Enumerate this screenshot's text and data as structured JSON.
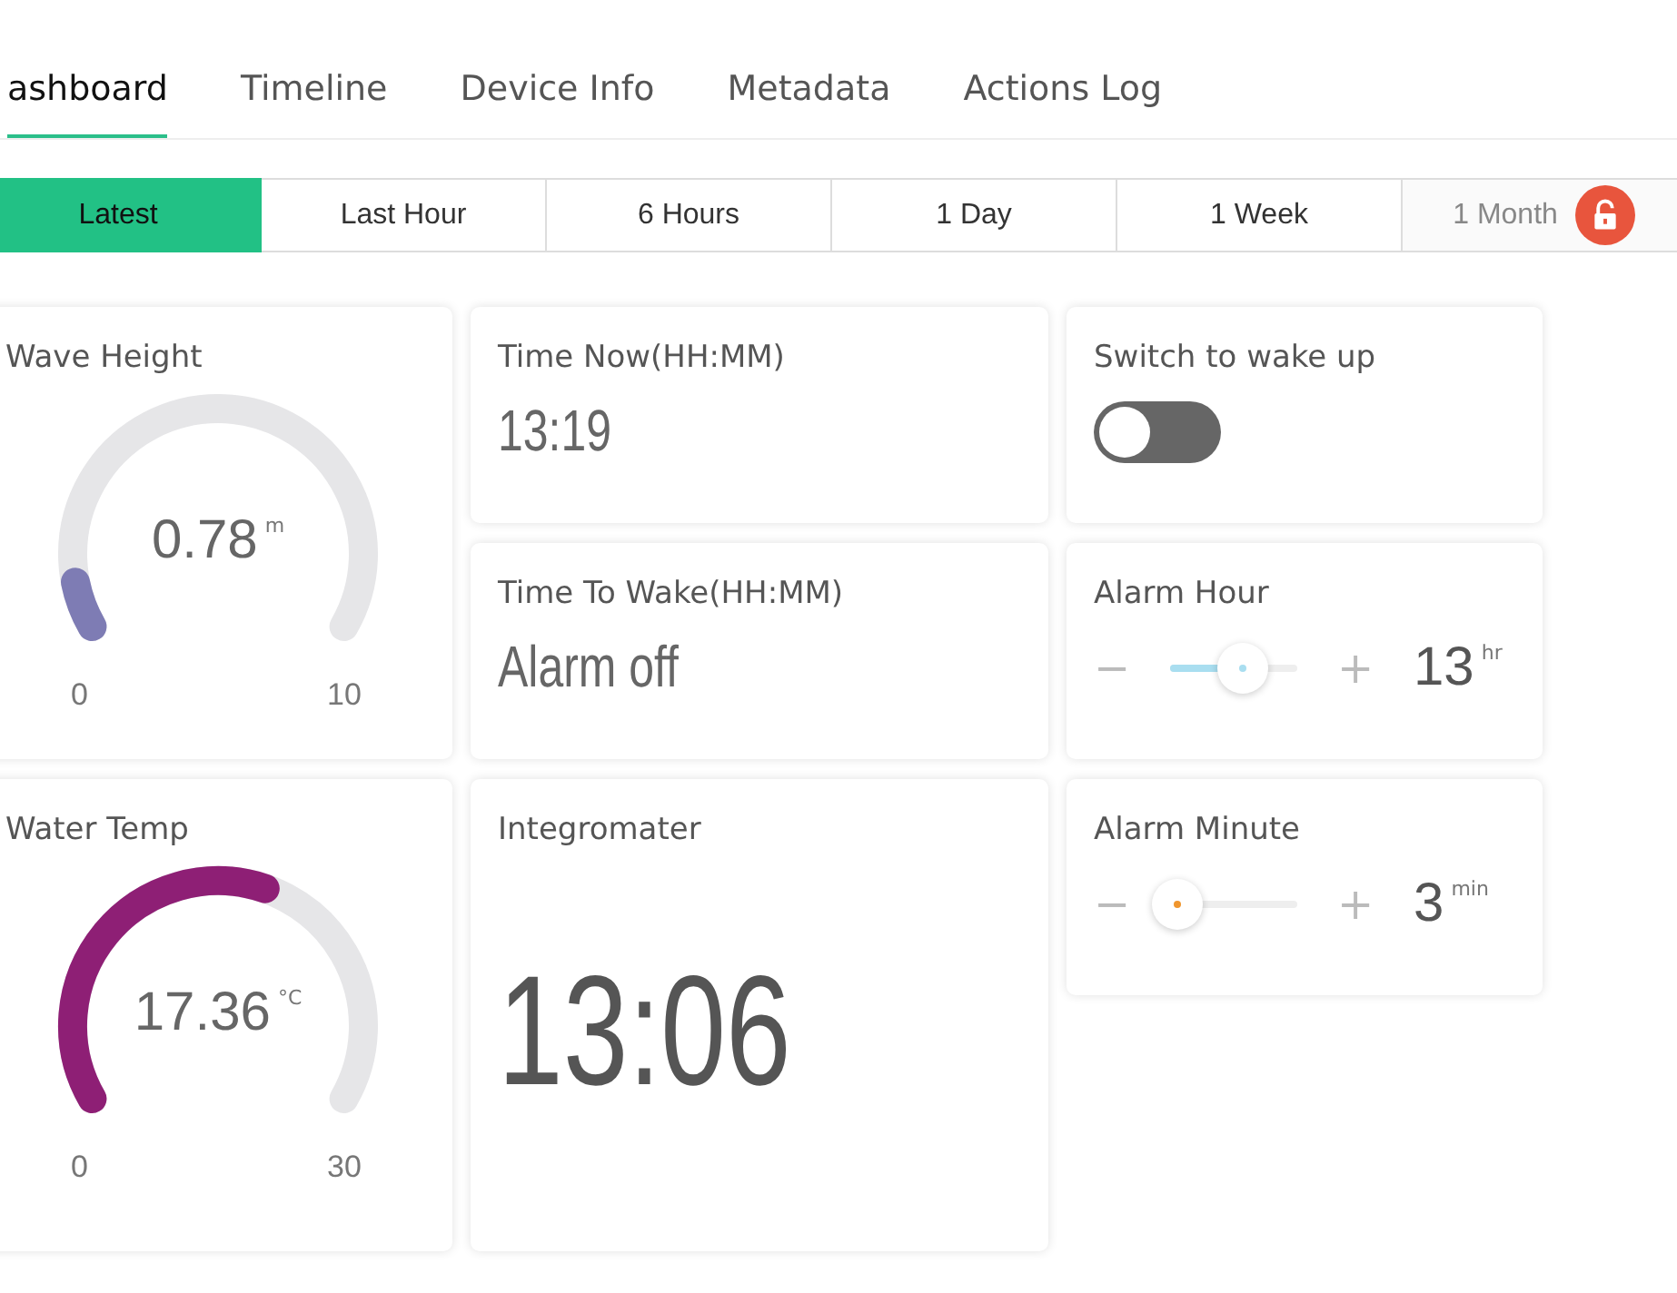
{
  "tabs": [
    {
      "label": "ashboard",
      "selected": true
    },
    {
      "label": "Timeline",
      "selected": false
    },
    {
      "label": "Device Info",
      "selected": false
    },
    {
      "label": "Metadata",
      "selected": false
    },
    {
      "label": "Actions Log",
      "selected": false
    }
  ],
  "ranges": [
    {
      "label": "Latest",
      "selected": true,
      "locked": false
    },
    {
      "label": "Last Hour",
      "selected": false,
      "locked": false
    },
    {
      "label": "6 Hours",
      "selected": false,
      "locked": false
    },
    {
      "label": "1 Day",
      "selected": false,
      "locked": false
    },
    {
      "label": "1 Week",
      "selected": false,
      "locked": false
    },
    {
      "label": "1 Month",
      "selected": false,
      "locked": true
    }
  ],
  "widgets": [
    {
      "kind": "gauge",
      "title": "Wave Height",
      "value": "0.78",
      "unit": "m",
      "min": "0",
      "max": "10",
      "color": "#7e7cb4"
    },
    {
      "kind": "text",
      "title": "Time Now(HH:MM)",
      "value": "13:19"
    },
    {
      "kind": "switch",
      "title": "Switch to wake up",
      "on": false
    },
    {
      "kind": "text",
      "title": "Time To Wake(HH:MM)",
      "value": "Alarm off"
    },
    {
      "kind": "slider",
      "title": "Alarm Hour",
      "minus": "−",
      "plus": "+",
      "value": "13",
      "unit": "hr",
      "color": "#a9def0"
    },
    {
      "kind": "gauge",
      "title": "Water Temp",
      "value": "17.36",
      "unit": "°C",
      "min": "0",
      "max": "30",
      "color": "#8e1f75"
    },
    {
      "kind": "big",
      "title": "Integromater",
      "value": "13:06"
    },
    {
      "kind": "slider",
      "title": "Alarm Minute",
      "minus": "−",
      "plus": "+",
      "value": "3",
      "unit": "min",
      "color": "#f0962e"
    }
  ]
}
